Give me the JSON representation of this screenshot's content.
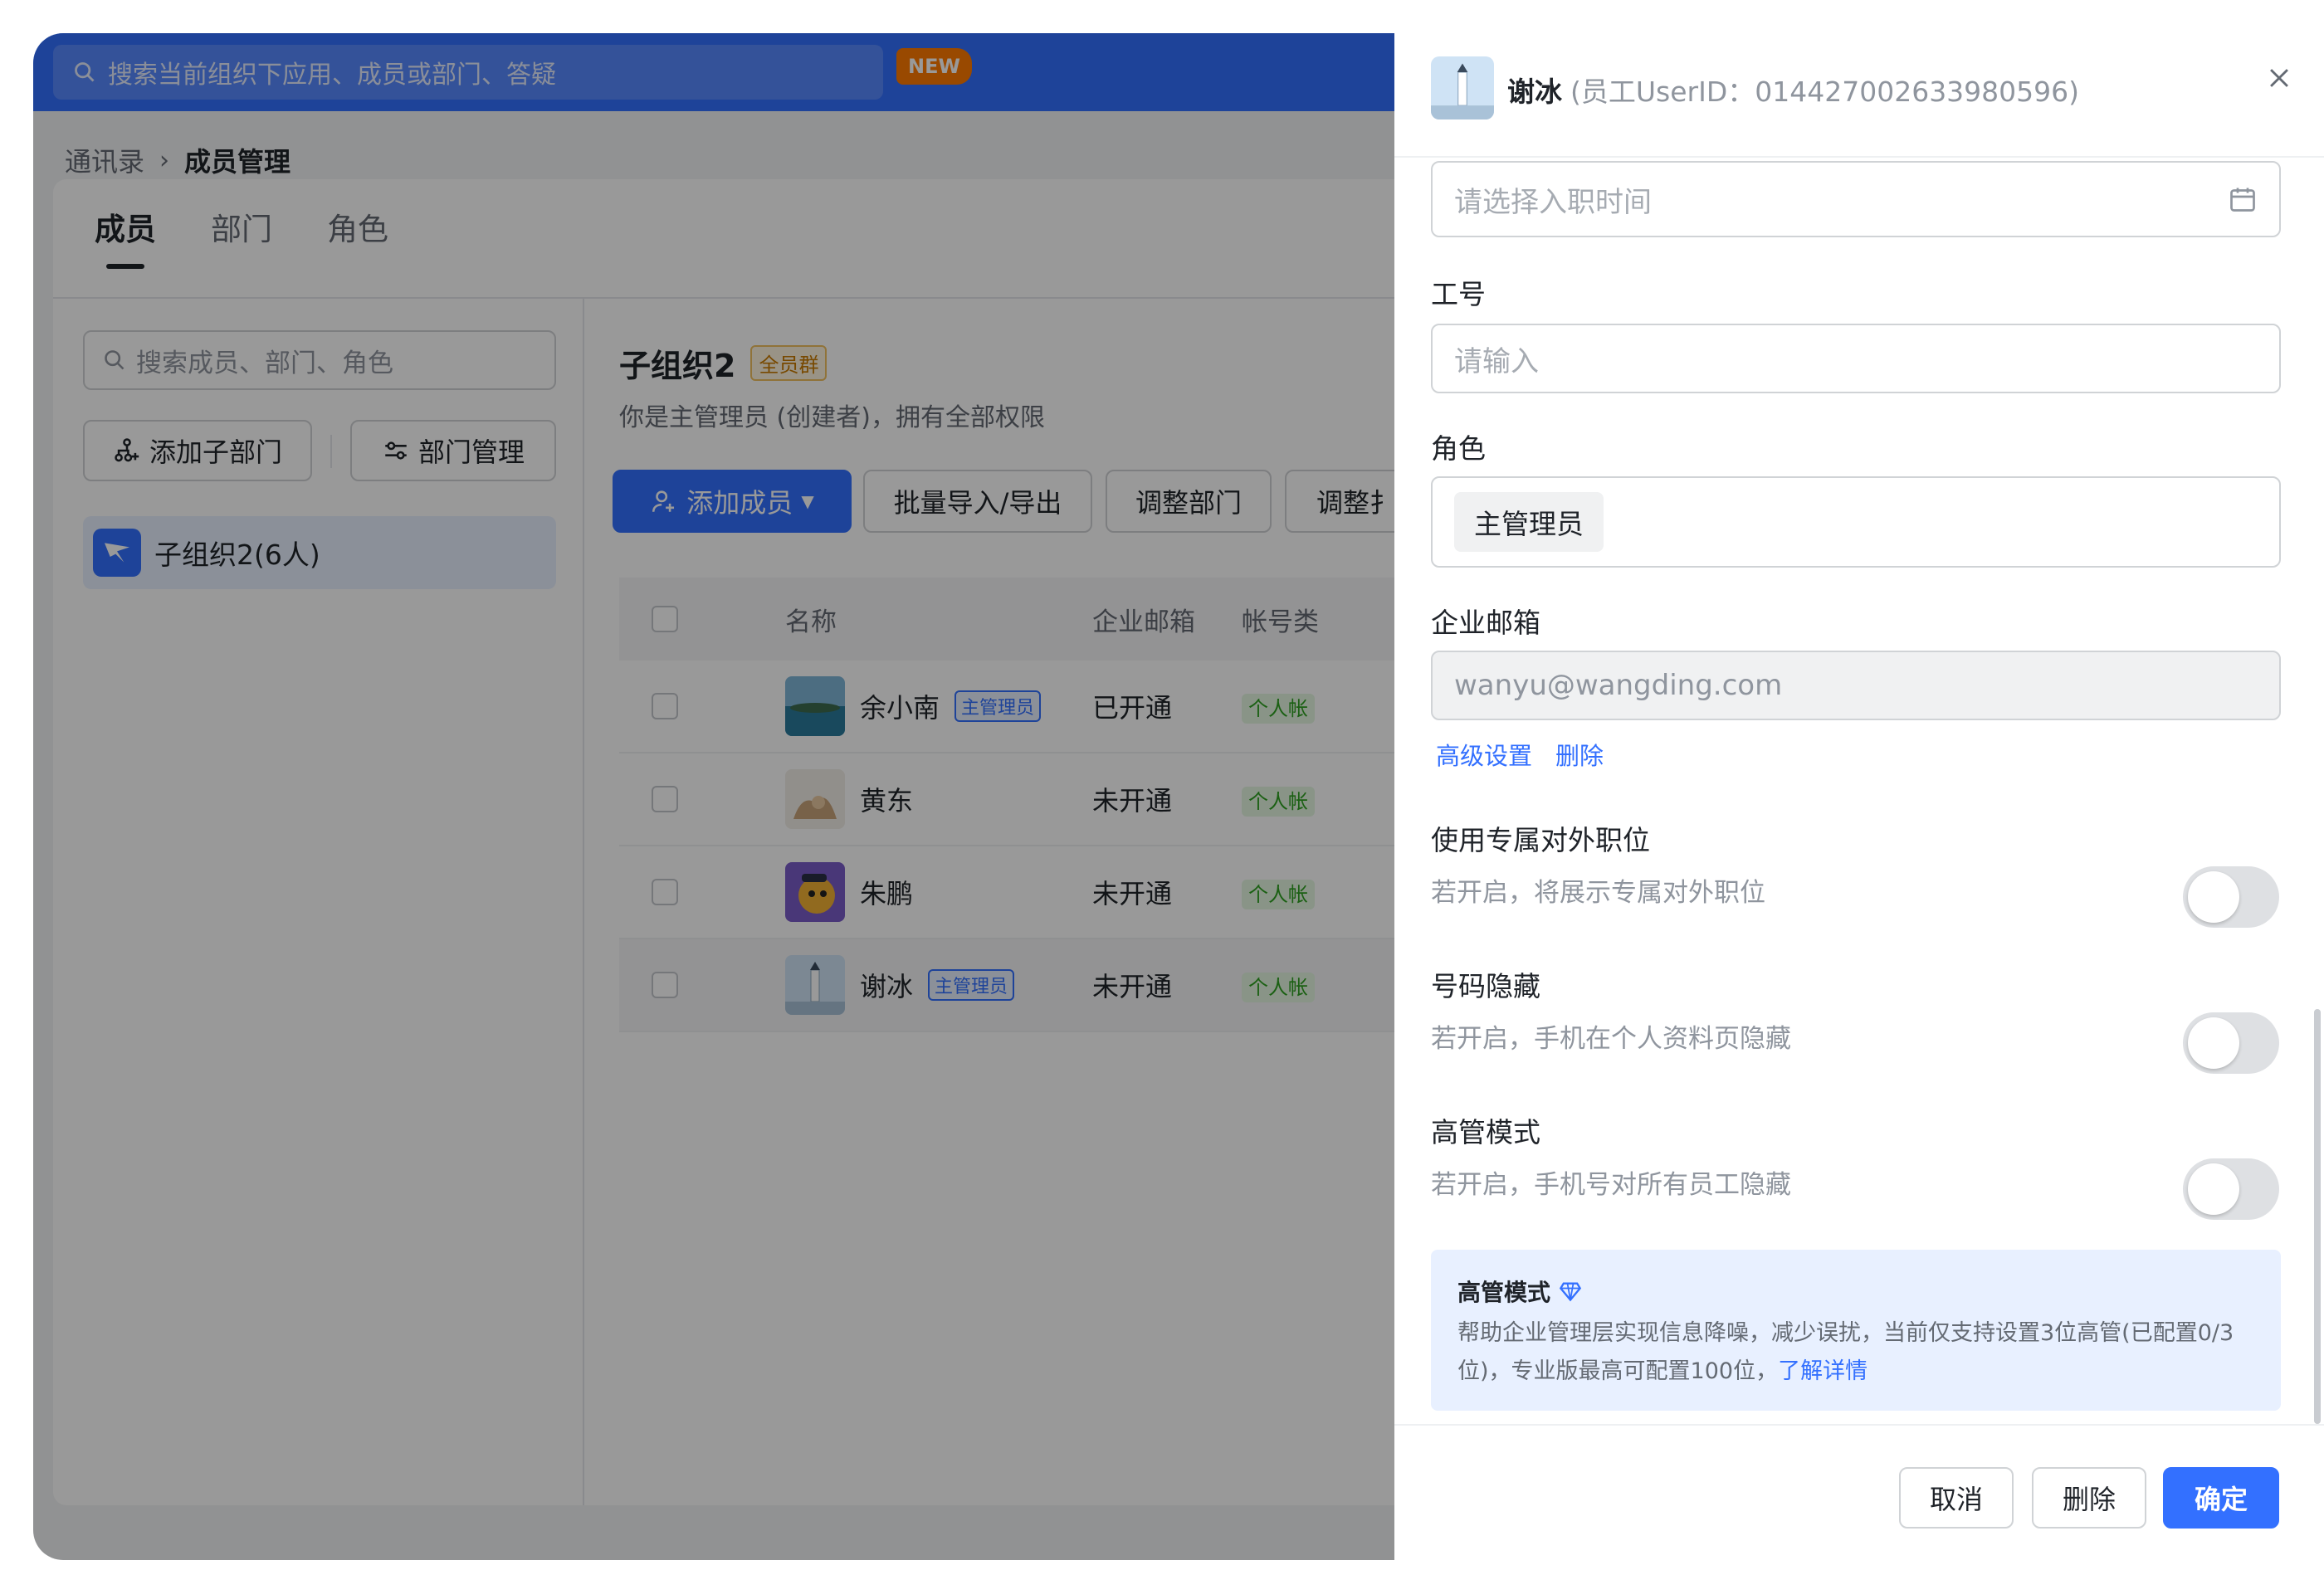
{
  "topbar": {
    "search_placeholder": "搜索当前组织下应用、成员或部门、答疑",
    "new_badge": "NEW"
  },
  "breadcrumb": {
    "parent": "通讯录",
    "current": "成员管理"
  },
  "tabs": [
    {
      "label": "成员",
      "active": true
    },
    {
      "label": "部门",
      "active": false
    },
    {
      "label": "角色",
      "active": false
    }
  ],
  "left_pane": {
    "search_placeholder": "搜索成员、部门、角色",
    "add_subdept": "添加子部门",
    "dept_manage": "部门管理",
    "org_item": "子组织2(6人)"
  },
  "right_pane": {
    "org_title": "子组织2",
    "all_member_badge": "全员群",
    "org_desc": "你是主管理员 (创建者)，拥有全部权限",
    "add_member": "添加成员",
    "batch": "批量导入/导出",
    "adjust_dept": "调整部门",
    "adjust_more": "调整扌"
  },
  "table": {
    "columns": [
      "名称",
      "企业邮箱",
      "帐号类"
    ],
    "rows": [
      {
        "name": "余小南",
        "role": "主管理员",
        "mail": "已开通",
        "type": "个人帐"
      },
      {
        "name": "黄东",
        "role": "",
        "mail": "未开通",
        "type": "个人帐"
      },
      {
        "name": "朱鹏",
        "role": "",
        "mail": "未开通",
        "type": "个人帐"
      },
      {
        "name": "谢冰",
        "role": "主管理员",
        "mail": "未开通",
        "type": "个人帐"
      }
    ]
  },
  "drawer": {
    "name": "谢冰",
    "userid": "(员工UserID：014427002633980596)",
    "hire_date_placeholder": "请选择入职时间",
    "employee_no_label": "工号",
    "employee_no_placeholder": "请输入",
    "role_label": "角色",
    "role_value": "主管理员",
    "email_label": "企业邮箱",
    "email_value": "wanyu@wangding.com",
    "advanced_settings": "高级设置",
    "delete_link": "删除",
    "exclusive_title": "使用专属对外职位",
    "exclusive_desc": "若开启，将展示专属对外职位",
    "exclusive_on": false,
    "hide_number_title": "号码隐藏",
    "hide_number_desc": "若开启，手机在个人资料页隐藏",
    "hide_number_on": false,
    "exec_mode_title": "高管模式",
    "exec_mode_desc": "若开启，手机号对所有员工隐藏",
    "exec_mode_on": false,
    "notice_title": "高管模式",
    "notice_text_1": "帮助企业管理层实现信息降噪，减少误扰，当前仅支持设置3位高管(已配置0/3",
    "notice_text_2": "位)，专业版最高可配置100位，",
    "notice_link": "了解详情",
    "cancel": "取消",
    "delete": "删除",
    "confirm": "确定"
  },
  "colors": {
    "primary": "#3370ff",
    "new_badge": "#ff7a00"
  }
}
